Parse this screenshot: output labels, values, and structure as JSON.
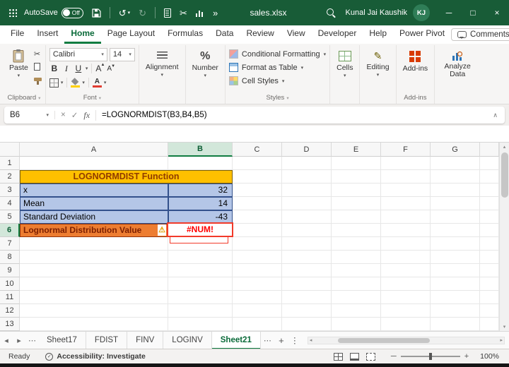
{
  "icons": {
    "dropdown": "▾",
    "undo": "↺",
    "redo": "↻",
    "cut": "✂",
    "more_chevrons": "»",
    "minimize": "─",
    "maximize": "□",
    "close": "×",
    "cancel": "×",
    "checkmark": "✓",
    "fx": "fx",
    "collapse": "∧",
    "ellipsis": "⋯",
    "vertical_dots": "⋮",
    "plus": "+",
    "nav_left": "◂",
    "nav_right": "▸",
    "scroll_up": "▴",
    "scroll_down": "▾",
    "warning": "⚠",
    "pencil": "✎",
    "percent": "%",
    "accessibility_check": "✓"
  },
  "title_bar": {
    "autosave_label": "AutoSave",
    "autosave_state": "Off",
    "filename": "sales.xlsx",
    "user_name": "Kunal Jai Kaushik",
    "user_initials": "KJ"
  },
  "menu": {
    "tabs": [
      "File",
      "Insert",
      "Home",
      "Page Layout",
      "Formulas",
      "Data",
      "Review",
      "View",
      "Developer",
      "Help",
      "Power Pivot"
    ],
    "active_tab": "Home",
    "comments_label": "Comments"
  },
  "ribbon": {
    "paste": "Paste",
    "clipboard_group": "Clipboard",
    "font_name": "Calibri",
    "font_size": "14",
    "bold": "B",
    "italic": "I",
    "underline": "U",
    "font_group": "Font",
    "alignment": "Alignment",
    "number": "Number",
    "conditional_formatting": "Conditional Formatting",
    "format_as_table": "Format as Table",
    "cell_styles": "Cell Styles",
    "styles_group": "Styles",
    "cells": "Cells",
    "editing": "Editing",
    "addins": "Add-ins",
    "addins_group": "Add-ins",
    "analyze_data": "Analyze Data"
  },
  "formula_bar": {
    "name_box": "B6",
    "formula": "=LOGNORMDIST(B3,B4,B5)"
  },
  "grid": {
    "columns": [
      "A",
      "B",
      "C",
      "D",
      "E",
      "F",
      "G"
    ],
    "num_rows": 13,
    "selected_column": "B",
    "selected_row": 6,
    "selected_cell": "B6",
    "title_row": 2,
    "table_title": "LOGNORMDIST Function",
    "rows_data": {
      "3": {
        "label": "x",
        "value": "32",
        "fill": "blue"
      },
      "4": {
        "label": "Mean",
        "value": "14",
        "fill": "blue"
      },
      "5": {
        "label": "Standard Deviation",
        "value": "-43",
        "fill": "blue"
      },
      "6": {
        "label": "Lognormal Distribution Value",
        "value": "#NUM!",
        "fill": "orange",
        "warning": true,
        "annotated": true
      }
    }
  },
  "sheet_tabs": {
    "tabs": [
      "Sheet17",
      "FDIST",
      "FINV",
      "LOGINV",
      "Sheet21"
    ],
    "active": "Sheet21"
  },
  "status_bar": {
    "ready_label": "Ready",
    "accessibility_label": "Accessibility: Investigate",
    "zoom_level": "100%"
  },
  "colors": {
    "titlebar_green": "#185C37",
    "accent_green": "#107C41",
    "selection_header_bg": "#D2E7DA",
    "header_gold": "#FFC000",
    "gold_text": "#8F3B00",
    "cell_blue": "#B4C6E7",
    "blue_border": "#33518C",
    "cell_orange": "#ED7D31",
    "orange_text": "#7C1F00",
    "orange_border": "#93330A",
    "error_red": "#FF0000",
    "annotation_red": "#F23A2A"
  }
}
